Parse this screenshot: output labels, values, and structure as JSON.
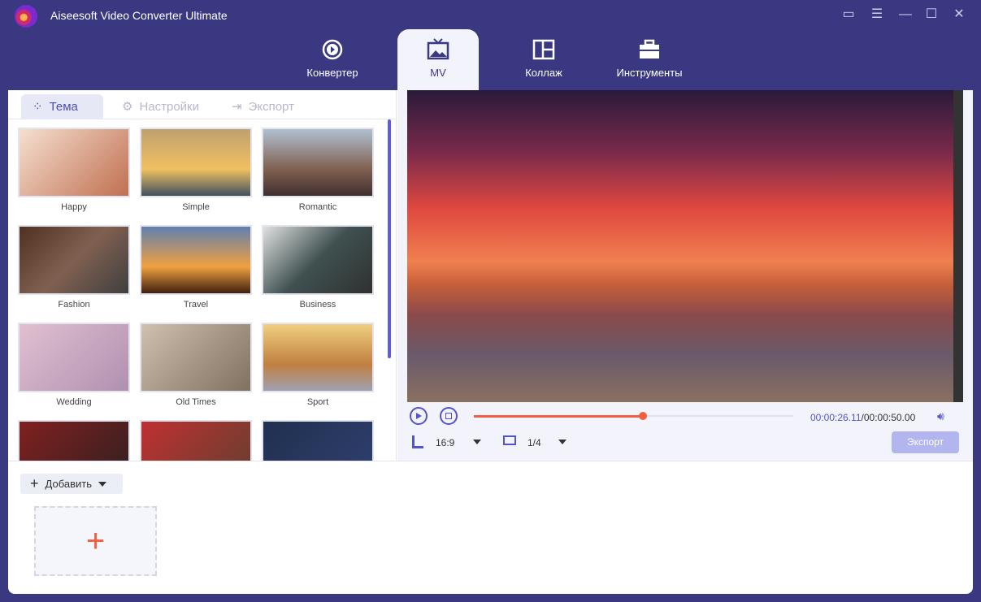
{
  "app": {
    "title": "Aiseesoft Video Converter Ultimate"
  },
  "window_controls": [
    {
      "icon": "feedback-icon"
    },
    {
      "icon": "menu-icon"
    },
    {
      "icon": "minimize-icon"
    },
    {
      "icon": "maximize-icon"
    },
    {
      "icon": "close-icon"
    }
  ],
  "nav": [
    {
      "label": "Конвертер",
      "icon": "convert-icon"
    },
    {
      "label": "MV",
      "icon": "tv-icon",
      "active": true
    },
    {
      "label": "Коллаж",
      "icon": "collage-icon"
    },
    {
      "label": "Инструменты",
      "icon": "toolbox-icon"
    }
  ],
  "tabs": [
    {
      "label": "Тема",
      "active": true
    },
    {
      "label": "Настройки"
    },
    {
      "label": "Экспорт"
    }
  ],
  "themes": [
    {
      "label": "Happy"
    },
    {
      "label": "Simple"
    },
    {
      "label": "Romantic"
    },
    {
      "label": "Fashion"
    },
    {
      "label": "Travel"
    },
    {
      "label": "Business"
    },
    {
      "label": "Wedding"
    },
    {
      "label": "Old Times"
    },
    {
      "label": "Sport"
    },
    {
      "label": ""
    },
    {
      "label": ""
    },
    {
      "label": ""
    }
  ],
  "player": {
    "current_time": "00:00:26.11",
    "total_time": "/00:00:50.00",
    "progress": 0.53,
    "aspect_ratio": "16:9",
    "screen": "1/4",
    "export_label": "Экспорт"
  },
  "bottom": {
    "add_label": "Добавить"
  },
  "colors": {
    "accent": "#5354c8",
    "progress": "#f06040",
    "background": "#3b3882"
  }
}
